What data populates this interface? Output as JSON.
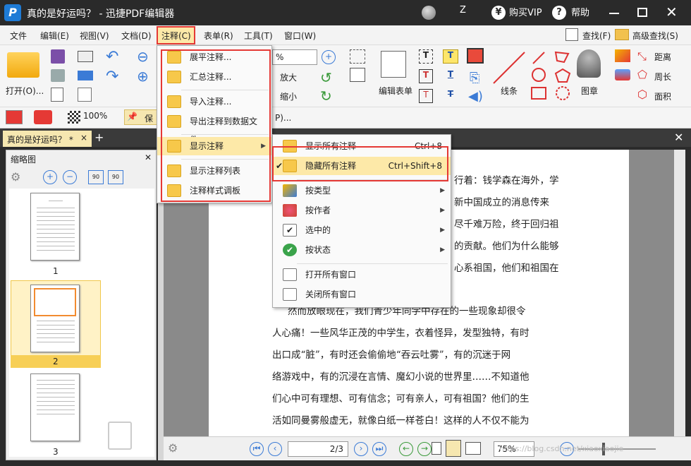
{
  "window": {
    "title": "真的是好运吗？ - 迅捷PDF编辑器",
    "user": "Z",
    "buy_vip": "购买VIP",
    "help": "帮助"
  },
  "menubar": [
    "文件",
    "编辑(E)",
    "视图(V)",
    "文档(D)",
    "注释(C)",
    "表单(R)",
    "工具(T)",
    "窗口(W)"
  ],
  "menubar_right": {
    "find": "查找(F)",
    "advanced_find": "高级查找(S)"
  },
  "toolbar": {
    "open": "打开(O)...",
    "zoom_in": "放大",
    "zoom_out": "缩小",
    "edit_form": "编辑表单",
    "line": "线条",
    "stamp": "图章",
    "distance": "距离",
    "perimeter": "周长",
    "area": "面积",
    "zoom_value": "100%",
    "keep": "保",
    "partial_p": "P)..."
  },
  "doc_tab": {
    "label": "真的是好运吗？ *",
    "close": "×",
    "add": "+"
  },
  "left_panel": {
    "title": "缩略图",
    "pages": [
      "1",
      "2",
      "3"
    ]
  },
  "document": {
    "lines": [
      "行着：钱学森在海外，学",
      "新中国成立的消息传来",
      "尽千难万险，终于回归祖",
      "的贡献。他们为什么能够",
      "心系祖国，他们和祖国在",
      "然而放眼现在，我们青少年同学中存在的一些现象却很令",
      "人心痛！一些风华正茂的中学生，衣着怪异，发型独特，有时",
      "出口成“脏”，有时还会偷偷地“吞云吐雾”，有的沉迷于网",
      "络游戏中，有的沉浸在言情、魔幻小说的世界里……不知道他",
      "们心中可有理想、可有信念；可有亲人，可有祖国？他们的生",
      "活如同曼雾般虚无，就像白纸一样苍白！这样的人不仅不能为"
    ]
  },
  "status": {
    "page_input": "2/3",
    "zoom": "75%",
    "watermark": "https://blog.csdn.net/xiaoxiaojie"
  },
  "annot_menu": {
    "items": [
      "展平注释...",
      "汇总注释...",
      "导入注释...",
      "导出注释到数据文件...",
      "显示注释",
      "显示注释列表",
      "注释样式调板"
    ]
  },
  "show_menu": {
    "items": [
      {
        "label": "显示所有注释",
        "shortcut": "Ctrl+8"
      },
      {
        "label": "隐藏所有注释",
        "shortcut": "Ctrl+Shift+8"
      },
      {
        "label": "按类型",
        "shortcut": ""
      },
      {
        "label": "按作者",
        "shortcut": ""
      },
      {
        "label": "选中的",
        "shortcut": ""
      },
      {
        "label": "按状态",
        "shortcut": ""
      },
      {
        "label": "打开所有窗口",
        "shortcut": ""
      },
      {
        "label": "关闭所有窗口",
        "shortcut": ""
      }
    ]
  },
  "colors": {
    "highlight_red": "#e53935",
    "menu_yellow": "#fde9a8",
    "accent_blue": "#3b7bd6"
  }
}
